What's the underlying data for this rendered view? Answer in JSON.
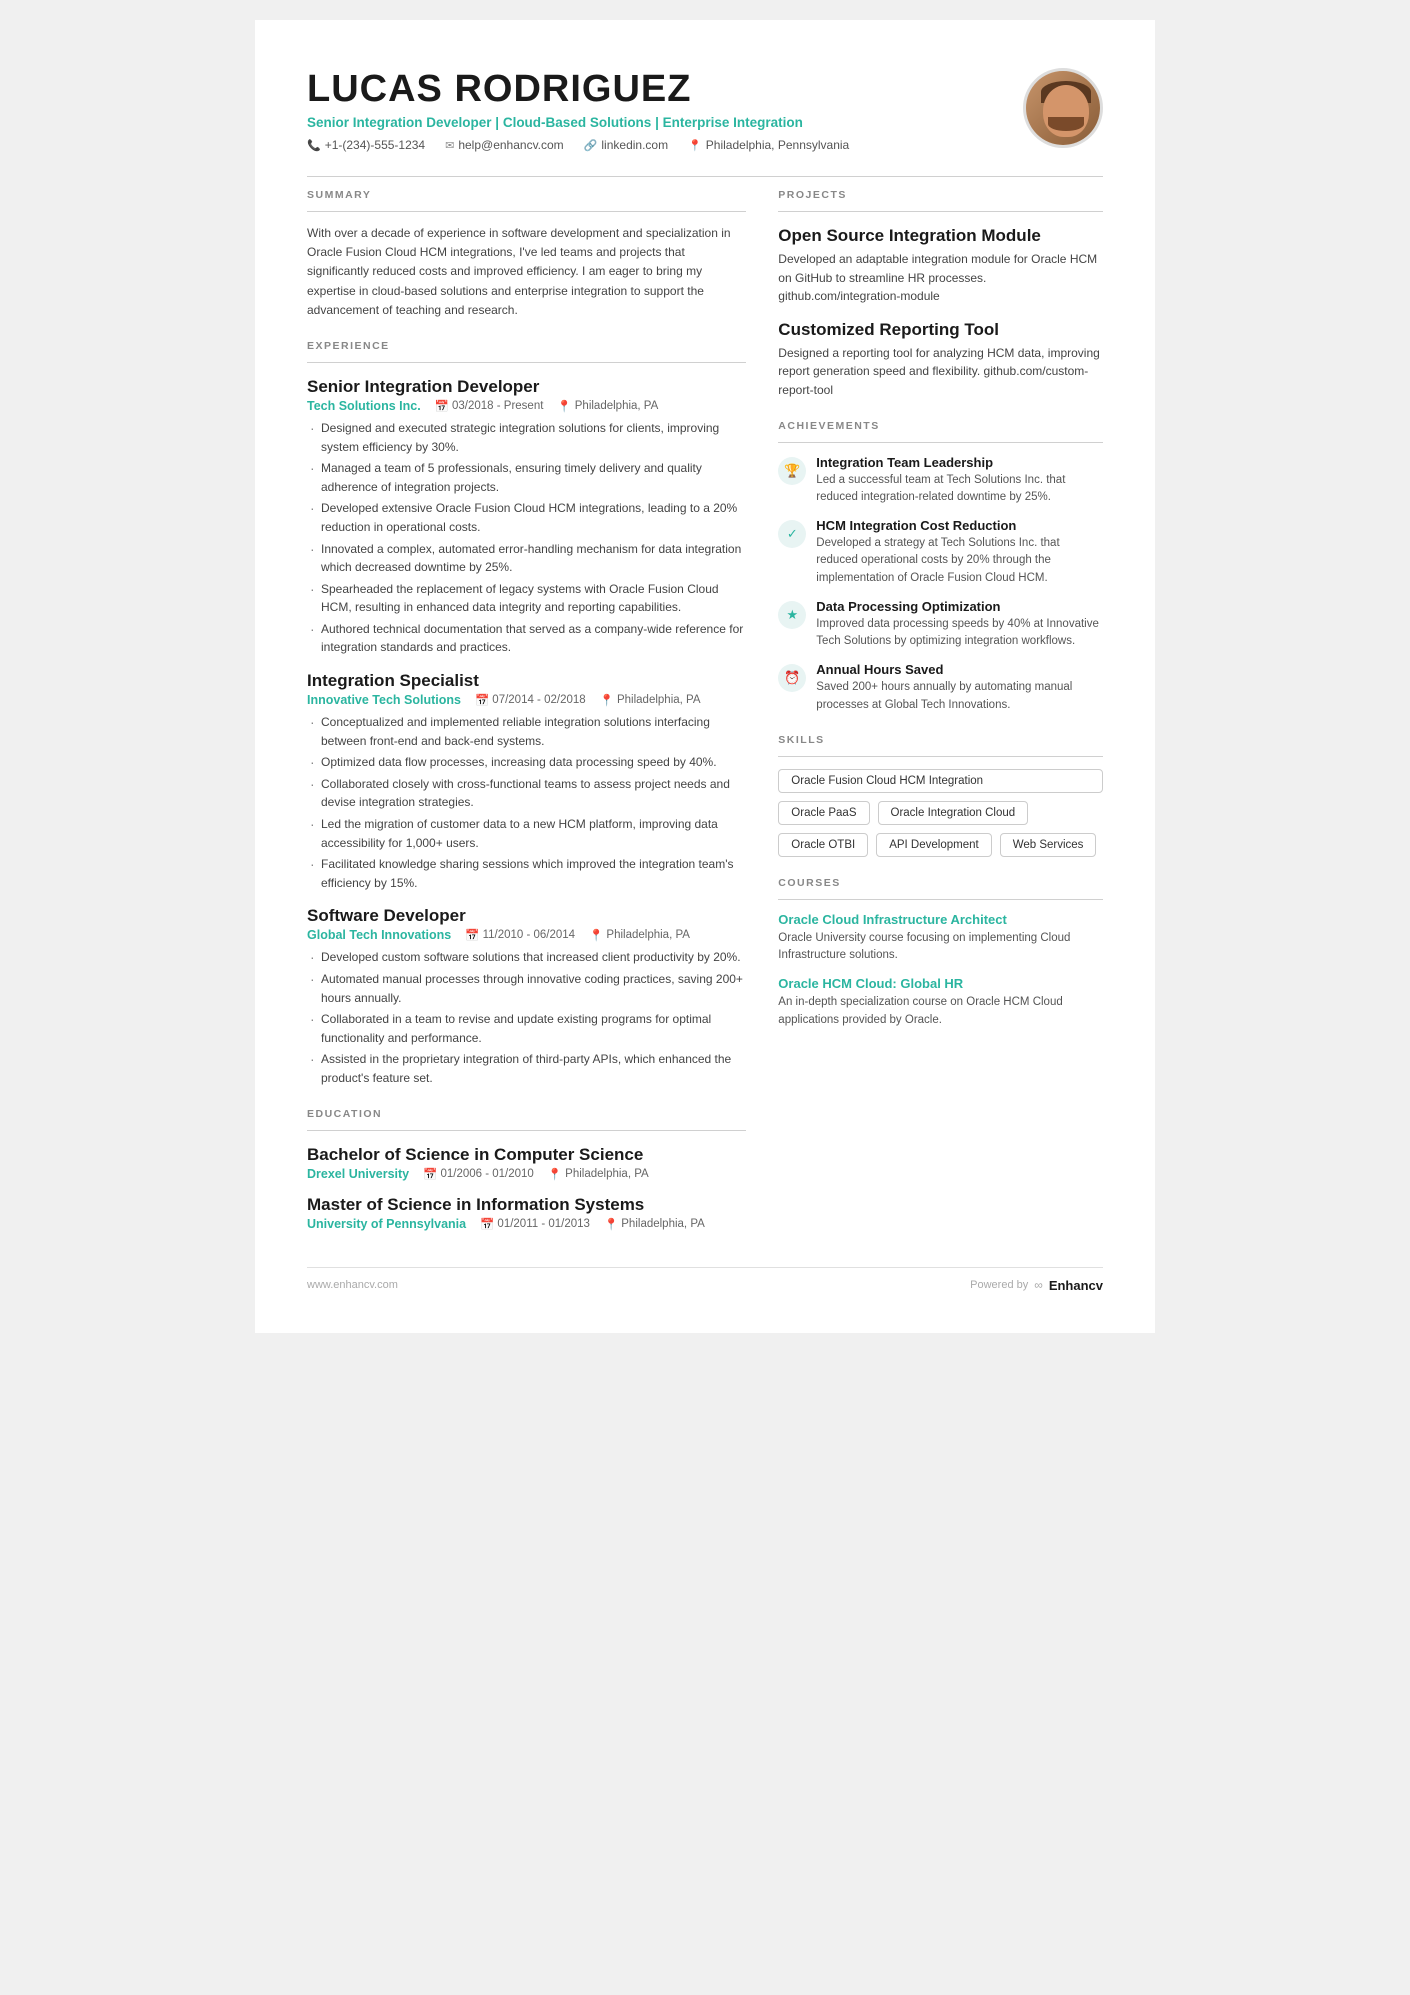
{
  "header": {
    "name": "LUCAS RODRIGUEZ",
    "title": "Senior Integration Developer | Cloud-Based Solutions | Enterprise Integration",
    "phone": "+1-(234)-555-1234",
    "email": "help@enhancv.com",
    "linkedin": "linkedin.com",
    "location": "Philadelphia, Pennsylvania"
  },
  "summary": {
    "label": "SUMMARY",
    "text": "With over a decade of experience in software development and specialization in Oracle Fusion Cloud HCM integrations, I've led teams and projects that significantly reduced costs and improved efficiency. I am eager to bring my expertise in cloud-based solutions and enterprise integration to support the advancement of teaching and research."
  },
  "experience": {
    "label": "EXPERIENCE",
    "jobs": [
      {
        "title": "Senior Integration Developer",
        "company": "Tech Solutions Inc.",
        "dates": "03/2018 - Present",
        "location": "Philadelphia, PA",
        "bullets": [
          "Designed and executed strategic integration solutions for clients, improving system efficiency by 30%.",
          "Managed a team of 5 professionals, ensuring timely delivery and quality adherence of integration projects.",
          "Developed extensive Oracle Fusion Cloud HCM integrations, leading to a 20% reduction in operational costs.",
          "Innovated a complex, automated error-handling mechanism for data integration which decreased downtime by 25%.",
          "Spearheaded the replacement of legacy systems with Oracle Fusion Cloud HCM, resulting in enhanced data integrity and reporting capabilities.",
          "Authored technical documentation that served as a company-wide reference for integration standards and practices."
        ]
      },
      {
        "title": "Integration Specialist",
        "company": "Innovative Tech Solutions",
        "dates": "07/2014 - 02/2018",
        "location": "Philadelphia, PA",
        "bullets": [
          "Conceptualized and implemented reliable integration solutions interfacing between front-end and back-end systems.",
          "Optimized data flow processes, increasing data processing speed by 40%.",
          "Collaborated closely with cross-functional teams to assess project needs and devise integration strategies.",
          "Led the migration of customer data to a new HCM platform, improving data accessibility for 1,000+ users.",
          "Facilitated knowledge sharing sessions which improved the integration team's efficiency by 15%."
        ]
      },
      {
        "title": "Software Developer",
        "company": "Global Tech Innovations",
        "dates": "11/2010 - 06/2014",
        "location": "Philadelphia, PA",
        "bullets": [
          "Developed custom software solutions that increased client productivity by 20%.",
          "Automated manual processes through innovative coding practices, saving 200+ hours annually.",
          "Collaborated in a team to revise and update existing programs for optimal functionality and performance.",
          "Assisted in the proprietary integration of third-party APIs, which enhanced the product's feature set."
        ]
      }
    ]
  },
  "education": {
    "label": "EDUCATION",
    "degrees": [
      {
        "degree": "Bachelor of Science in Computer Science",
        "school": "Drexel University",
        "dates": "01/2006 - 01/2010",
        "location": "Philadelphia, PA"
      },
      {
        "degree": "Master of Science in Information Systems",
        "school": "University of Pennsylvania",
        "dates": "01/2011 - 01/2013",
        "location": "Philadelphia, PA"
      }
    ]
  },
  "projects": {
    "label": "PROJECTS",
    "items": [
      {
        "title": "Open Source Integration Module",
        "desc": "Developed an adaptable integration module for Oracle HCM on GitHub to streamline HR processes. github.com/integration-module"
      },
      {
        "title": "Customized Reporting Tool",
        "desc": "Designed a reporting tool for analyzing HCM data, improving report generation speed and flexibility. github.com/custom-report-tool"
      }
    ]
  },
  "achievements": {
    "label": "ACHIEVEMENTS",
    "items": [
      {
        "icon": "🏆",
        "icon_class": "icon-trophy",
        "title": "Integration Team Leadership",
        "desc": "Led a successful team at Tech Solutions Inc. that reduced integration-related downtime by 25%."
      },
      {
        "icon": "✓",
        "icon_class": "icon-check",
        "title": "HCM Integration Cost Reduction",
        "desc": "Developed a strategy at Tech Solutions Inc. that reduced operational costs by 20% through the implementation of Oracle Fusion Cloud HCM."
      },
      {
        "icon": "★",
        "icon_class": "icon-star",
        "title": "Data Processing Optimization",
        "desc": "Improved data processing speeds by 40% at Innovative Tech Solutions by optimizing integration workflows."
      },
      {
        "icon": "⏰",
        "icon_class": "icon-clock",
        "title": "Annual Hours Saved",
        "desc": "Saved 200+ hours annually by automating manual processes at Global Tech Innovations."
      }
    ]
  },
  "skills": {
    "label": "SKILLS",
    "items": [
      {
        "name": "Oracle Fusion Cloud HCM Integration",
        "wide": true
      },
      {
        "name": "Oracle PaaS",
        "wide": false
      },
      {
        "name": "Oracle Integration Cloud",
        "wide": false
      },
      {
        "name": "Oracle OTBI",
        "wide": false
      },
      {
        "name": "API Development",
        "wide": false
      },
      {
        "name": "Web Services",
        "wide": false
      }
    ]
  },
  "courses": {
    "label": "COURSES",
    "items": [
      {
        "title": "Oracle Cloud Infrastructure Architect",
        "desc": "Oracle University course focusing on implementing Cloud Infrastructure solutions."
      },
      {
        "title": "Oracle HCM Cloud: Global HR",
        "desc": "An in-depth specialization course on Oracle HCM Cloud applications provided by Oracle."
      }
    ]
  },
  "footer": {
    "website": "www.enhancv.com",
    "powered_by": "Powered by",
    "brand": "Enhancv"
  }
}
